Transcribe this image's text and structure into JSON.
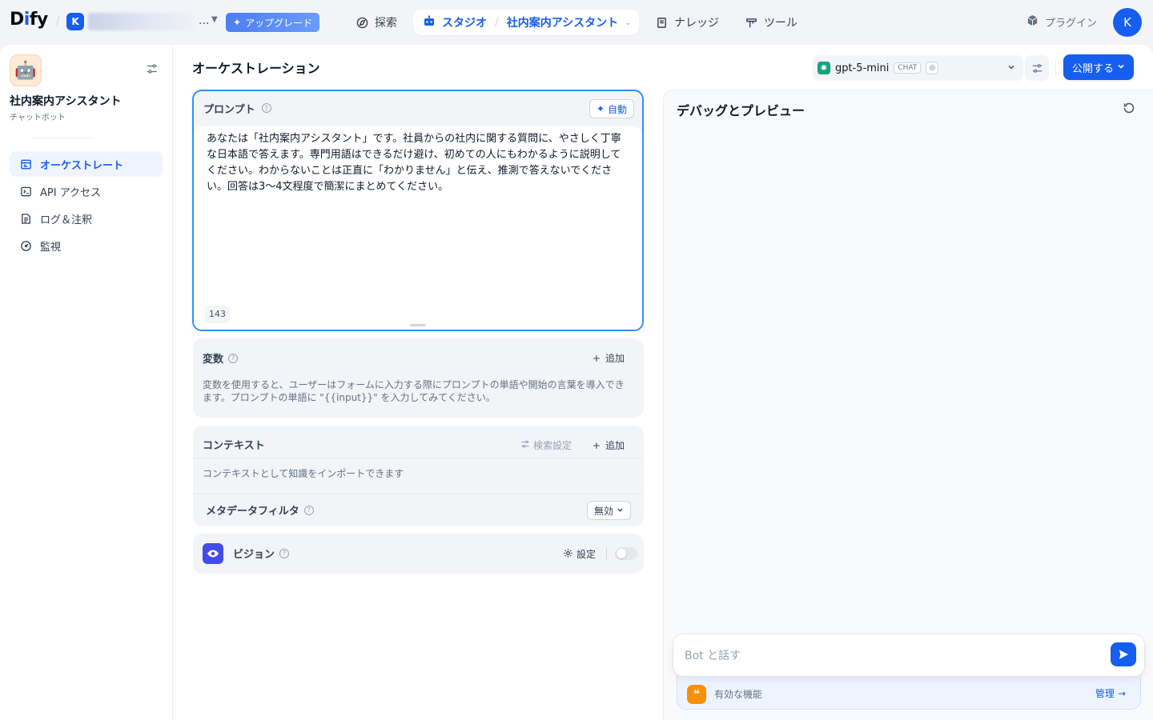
{
  "header": {
    "logo": "Dify",
    "workspace": {
      "avatar_letter": "K",
      "more": "..."
    },
    "upgrade_label": "アップグレード",
    "nav": {
      "explore": "探索",
      "studio": "スタジオ",
      "current_app": "社内案内アシスタント",
      "knowledge": "ナレッジ",
      "tools": "ツール"
    },
    "plugin_label": "プラグイン",
    "user_avatar": "K"
  },
  "sidebar": {
    "app_icon": "🤖",
    "app_name": "社内案内アシスタント",
    "app_type": "チャットボット",
    "items": [
      {
        "label": "オーケストレート",
        "icon": "orchestrate-icon",
        "active": true
      },
      {
        "label": "API アクセス",
        "icon": "terminal-icon",
        "active": false
      },
      {
        "label": "ログ＆注釈",
        "icon": "log-icon",
        "active": false
      },
      {
        "label": "監視",
        "icon": "gauge-icon",
        "active": false
      }
    ]
  },
  "main": {
    "title": "オーケストレーション",
    "model": {
      "name": "gpt-5-mini",
      "mode": "CHAT"
    },
    "publish_label": "公開する"
  },
  "prompt": {
    "title": "プロンプト",
    "auto_label": "自動",
    "text": "あなたは「社内案内アシスタント」です。社員からの社内に関する質問に、やさしく丁寧な日本語で答えます。専門用語はできるだけ避け、初めての人にもわかるように説明してください。わからないことは正直に「わかりません」と伝え、推測で答えないでください。回答は3〜4文程度で簡潔にまとめてください。",
    "char_count": "143"
  },
  "variables": {
    "title": "変数",
    "add_label": "追加",
    "description": "変数を使用すると、ユーザーはフォームに入力する際にプロンプトの単語や開始の言葉を導入できます。プロンプトの単語に \"{{input}}\" を入力してみてください。"
  },
  "context": {
    "title": "コンテキスト",
    "retrieval_label": "検索設定",
    "add_label": "追加",
    "description": "コンテキストとして知識をインポートできます",
    "metadata_filter_label": "メタデータフィルタ",
    "metadata_filter_value": "無効"
  },
  "vision": {
    "title": "ビジョン",
    "settings_label": "設定",
    "enabled": false
  },
  "debug": {
    "title": "デバッグとプレビュー",
    "input_placeholder": "Bot と話す",
    "features_label": "有効な機能",
    "manage_label": "管理"
  },
  "colors": {
    "accent": "#155eef",
    "focus_border": "#2e90fa",
    "vision_icon": "#444ce7",
    "feature_icon": "#f79009"
  }
}
